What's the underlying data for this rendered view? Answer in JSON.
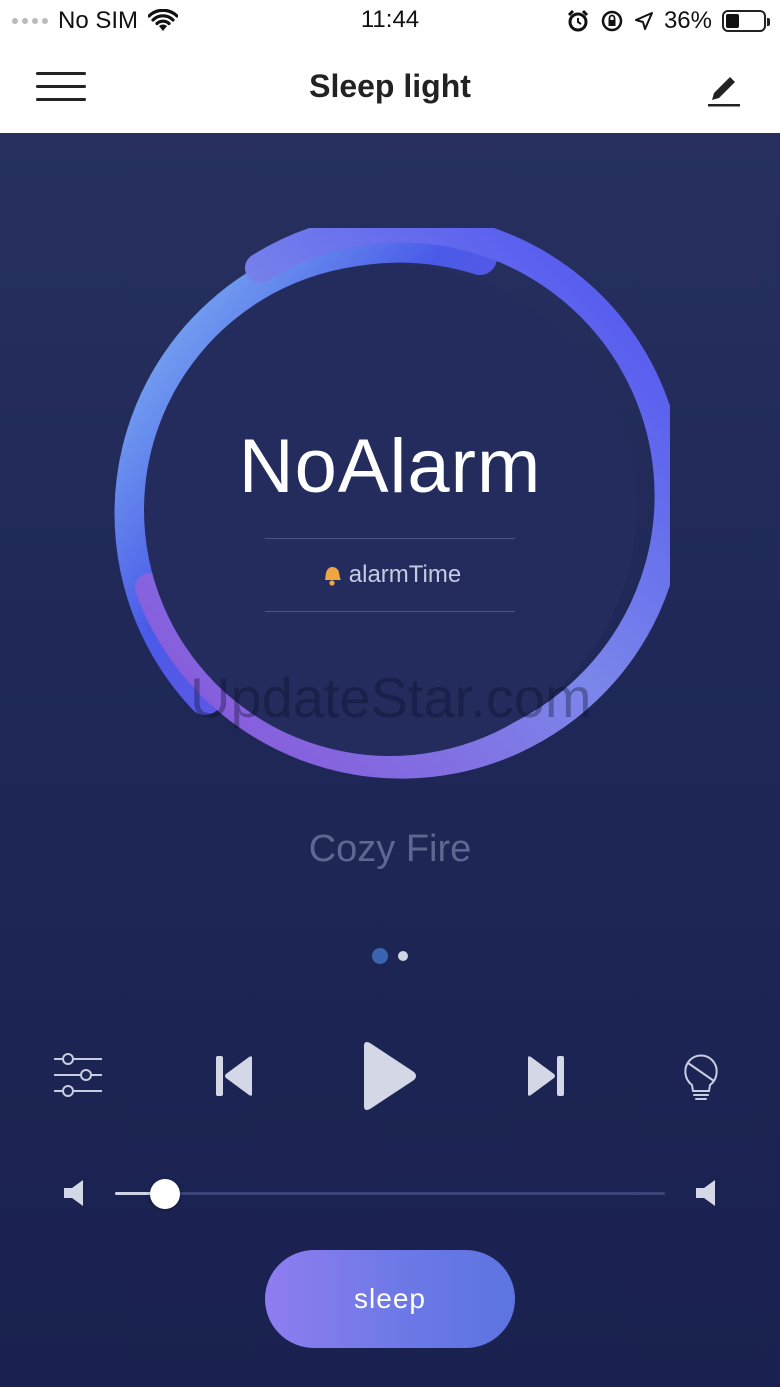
{
  "status_bar": {
    "carrier": "No SIM",
    "time": "11:44",
    "battery_percent": "36%",
    "battery_level": 0.36,
    "icons": [
      "signal-dots-icon",
      "wifi-icon",
      "alarm-clock-icon",
      "orientation-lock-icon",
      "location-arrow-icon",
      "battery-icon"
    ]
  },
  "nav": {
    "title": "Sleep light",
    "left_icon": "menu-icon",
    "right_icon": "edit-pencil-icon"
  },
  "player": {
    "alarm_status": "NoAlarm",
    "alarm_time_label": "alarmTime",
    "alarm_time_icon": "bell-icon",
    "watermark": "UpdateStar.com",
    "track_name": "Cozy Fire",
    "page_count": 2,
    "active_page": 0,
    "controls": [
      "equalizer-icon",
      "previous-icon",
      "play-icon",
      "next-icon",
      "bulb-icon"
    ],
    "volume_level": 0.09,
    "sleep_button": "sleep"
  },
  "colors": {
    "ring_start": "#86c2f4",
    "ring_mid": "#4a5ae8",
    "ring_end": "#7d55de",
    "background_top": "#27305e",
    "background_bottom": "#1a2150",
    "sleep_button_start": "#8f7df0",
    "sleep_button_end": "#5d74e0",
    "bell": "#f0a640"
  }
}
